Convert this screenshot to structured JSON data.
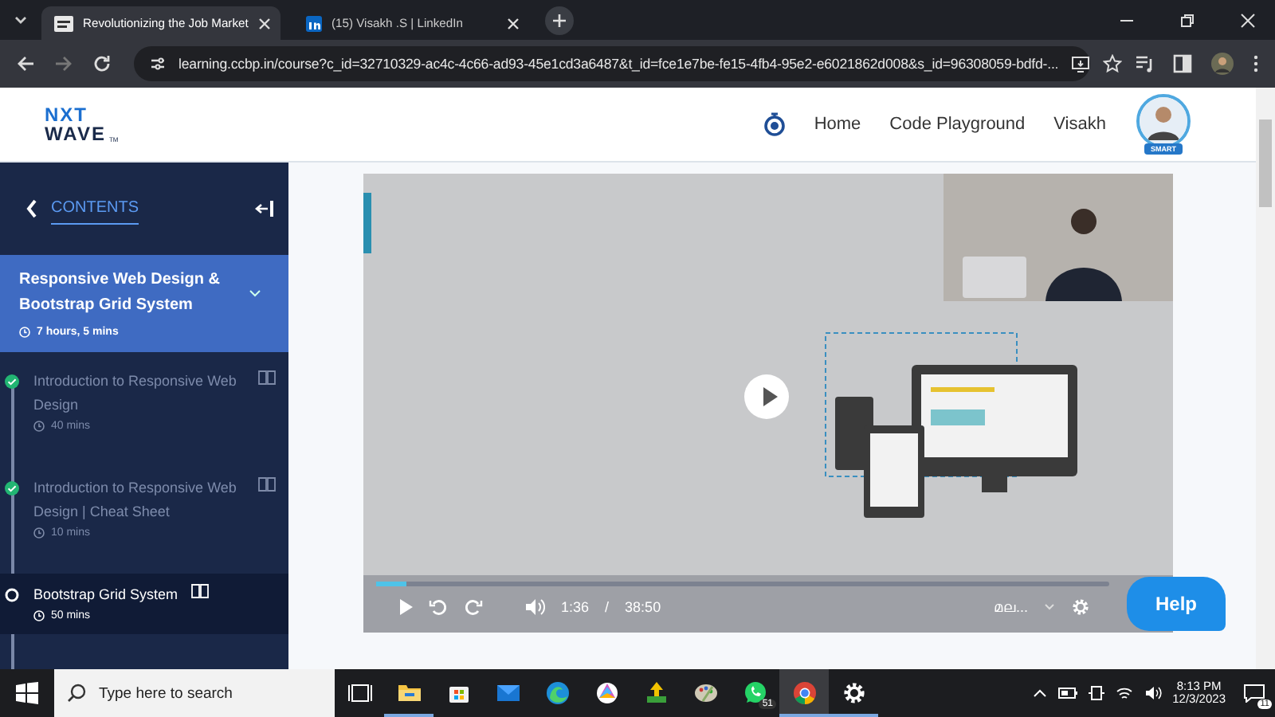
{
  "browser": {
    "tabs": [
      {
        "title": "Revolutionizing the Job Market",
        "selected": true
      },
      {
        "title": "(15) Visakh .S | LinkedIn",
        "selected": false
      }
    ],
    "address": "learning.ccbp.in/course?c_id=32710329-ac4c-4c66-ad93-45e1cd3a6487&t_id=fce1e7be-fe15-4fb4-95e2-e6021862d008&s_id=96308059-bdfd-..."
  },
  "header": {
    "logo_top": "NXT",
    "logo_bottom": "WAVE",
    "logo_mark": "TM",
    "nav": [
      "Home",
      "Code Playground"
    ],
    "user": "Visakh",
    "badge": "SMART"
  },
  "sidebar": {
    "title": "CONTENTS",
    "module": {
      "title": "Responsive Web Design & Bootstrap Grid System",
      "duration": "7 hours, 5 mins",
      "expanded": true
    },
    "lessons": [
      {
        "title": "Introduction to Responsive Web Design",
        "duration": "40 mins",
        "completed": true,
        "selected": false
      },
      {
        "title": "Introduction to Responsive Web Design | Cheat Sheet",
        "duration": "10 mins",
        "completed": true,
        "selected": false
      },
      {
        "title": "Bootstrap Grid System",
        "duration": "50 mins",
        "completed": false,
        "selected": true
      }
    ]
  },
  "video": {
    "kind": "picture",
    "paused": true,
    "progress": {
      "level": 0.041
    },
    "current_time": "1:36",
    "time_separator": "/",
    "duration": "38:50",
    "language": "മല..."
  },
  "help_button": "Help",
  "taskbar": {
    "search": {
      "placeholder": "Type here to search"
    },
    "apps": [
      {
        "kind": "taskview",
        "running": false
      },
      {
        "kind": "folder",
        "running": true
      },
      {
        "kind": "store",
        "running": false
      },
      {
        "kind": "mail",
        "running": false
      },
      {
        "kind": "edge",
        "running": false
      },
      {
        "kind": "photos",
        "running": false
      },
      {
        "kind": "upload",
        "running": false
      },
      {
        "kind": "paint",
        "running": false
      },
      {
        "kind": "chat",
        "running": false,
        "badge": "51"
      },
      {
        "kind": "chrome",
        "running": true,
        "selected": true
      },
      {
        "kind": "gear",
        "running": true
      }
    ],
    "time": "8:13 PM",
    "date": "12/3/2023",
    "notifications": "11"
  }
}
